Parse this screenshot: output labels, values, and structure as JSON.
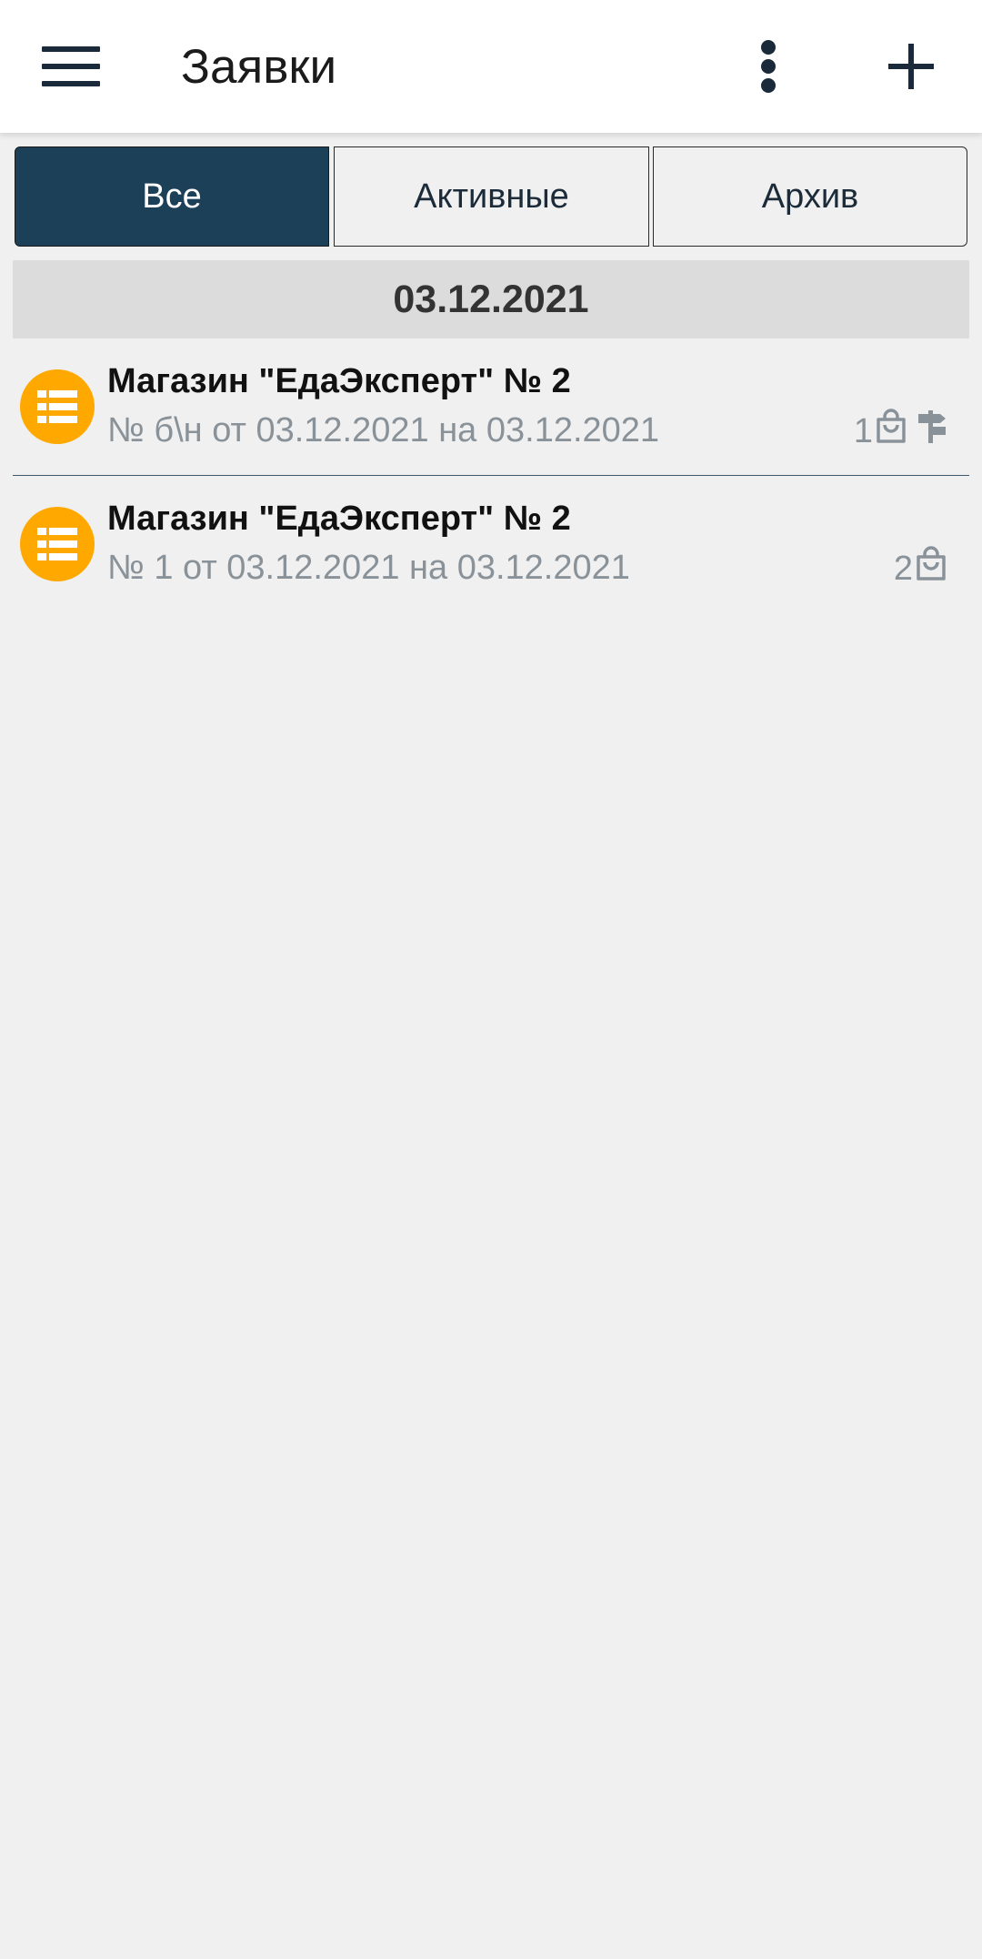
{
  "header": {
    "title": "Заявки",
    "menu_icon": "hamburger-menu-icon",
    "more_icon": "more-vertical-icon",
    "add_icon": "plus-icon"
  },
  "tabs": [
    {
      "label": "Все",
      "active": true
    },
    {
      "label": "Активные",
      "active": false
    },
    {
      "label": "Архив",
      "active": false
    }
  ],
  "groups": [
    {
      "date": "03.12.2021",
      "items": [
        {
          "title": "Магазин \"ЕдаЭксперт\" № 2",
          "subtitle": "№ б\\н от 03.12.2021 на 03.12.2021",
          "count": "1",
          "icons": [
            "shopping-bag-icon",
            "signpost-icon"
          ]
        },
        {
          "title": "Магазин \"ЕдаЭксперт\" № 2",
          "subtitle": "№ 1 от 03.12.2021 на 03.12.2021",
          "count": "2",
          "icons": [
            "shopping-bag-icon"
          ]
        }
      ]
    }
  ],
  "colors": {
    "accent": "#1d4059",
    "item_icon_bg": "#ffa800",
    "background": "#f0f0f0",
    "date_header_bg": "#dcdcdc",
    "secondary_text": "#8a9299"
  }
}
